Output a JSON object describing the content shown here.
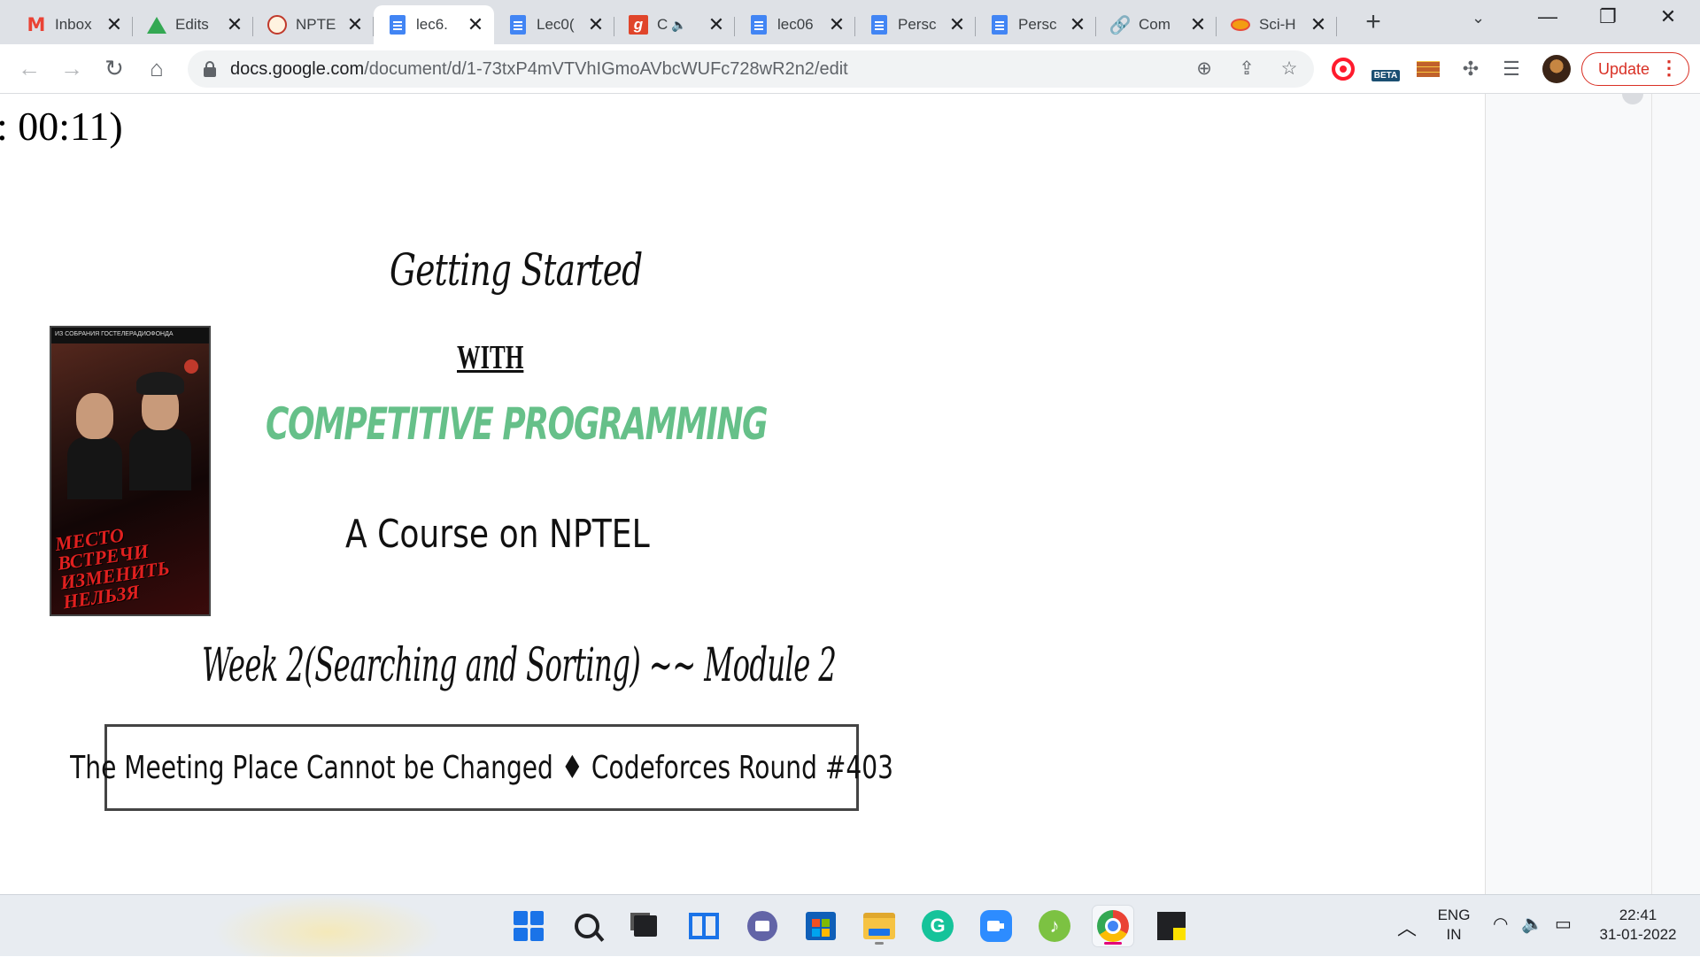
{
  "browser": {
    "tabs": [
      {
        "title": "Inbox",
        "favicon": "gmail-icon",
        "active": false
      },
      {
        "title": "Edits",
        "favicon": "drive-icon",
        "active": false
      },
      {
        "title": "NPTE",
        "favicon": "nptel-icon",
        "active": false
      },
      {
        "title": "lec6.",
        "favicon": "docs-icon",
        "active": true
      },
      {
        "title": "Lec0(",
        "favicon": "docs-icon",
        "active": false
      },
      {
        "title": "C",
        "favicon": "g-app-icon",
        "active": false,
        "audio": true
      },
      {
        "title": "lec06",
        "favicon": "docs-icon",
        "active": false
      },
      {
        "title": "Persc",
        "favicon": "docs-icon",
        "active": false
      },
      {
        "title": "Persc",
        "favicon": "docs-icon",
        "active": false
      },
      {
        "title": "Com",
        "favicon": "link-icon",
        "active": false
      },
      {
        "title": "Sci-H",
        "favicon": "scihub-icon",
        "active": false
      }
    ],
    "tab_close_glyph": "✕",
    "new_tab_glyph": "+",
    "url_host": "docs.google.com",
    "url_path": "/document/d/1-73txP4mVTVhIGmoAVbcWUFc728wR2n2/edit",
    "extension_beta_label": "BETA",
    "update_label": "Update",
    "colors": {
      "update": "#d93025",
      "tab_strip": "#dee1e6"
    }
  },
  "document": {
    "timestamp_fragment": ": 00:11)",
    "slide": {
      "title_line1": "Getting Started",
      "title_line2": "WITH",
      "title_line3": "COMPETITIVE PROGRAMMING",
      "subtitle": "A Course on NPTEL",
      "week_line": "Week 2(Searching and Sorting) ~~ Module 2",
      "problem_box": "The Meeting Place Cannot be Changed ♦ Codeforces Round #403",
      "poster_title": "МЕСТО ВСТРЕЧИ ИЗМЕНИТЬ НЕЛЬЗЯ",
      "poster_banner": "ИЗ СОБРАНИЯ ГОСТЕЛЕРАДИОФОНДА",
      "colors": {
        "title_line3": "#66c089"
      }
    }
  },
  "taskbar": {
    "language_line1": "ENG",
    "language_line2": "IN",
    "time": "22:41",
    "date": "31-01-2022",
    "apps": [
      "start-icon",
      "search-icon",
      "task-view-icon",
      "widgets-icon",
      "teams-chat-icon",
      "microsoft-store-icon",
      "file-explorer-icon",
      "grammarly-icon",
      "zoom-icon",
      "green-app-icon",
      "chrome-icon",
      "sticky-notes-icon"
    ]
  }
}
